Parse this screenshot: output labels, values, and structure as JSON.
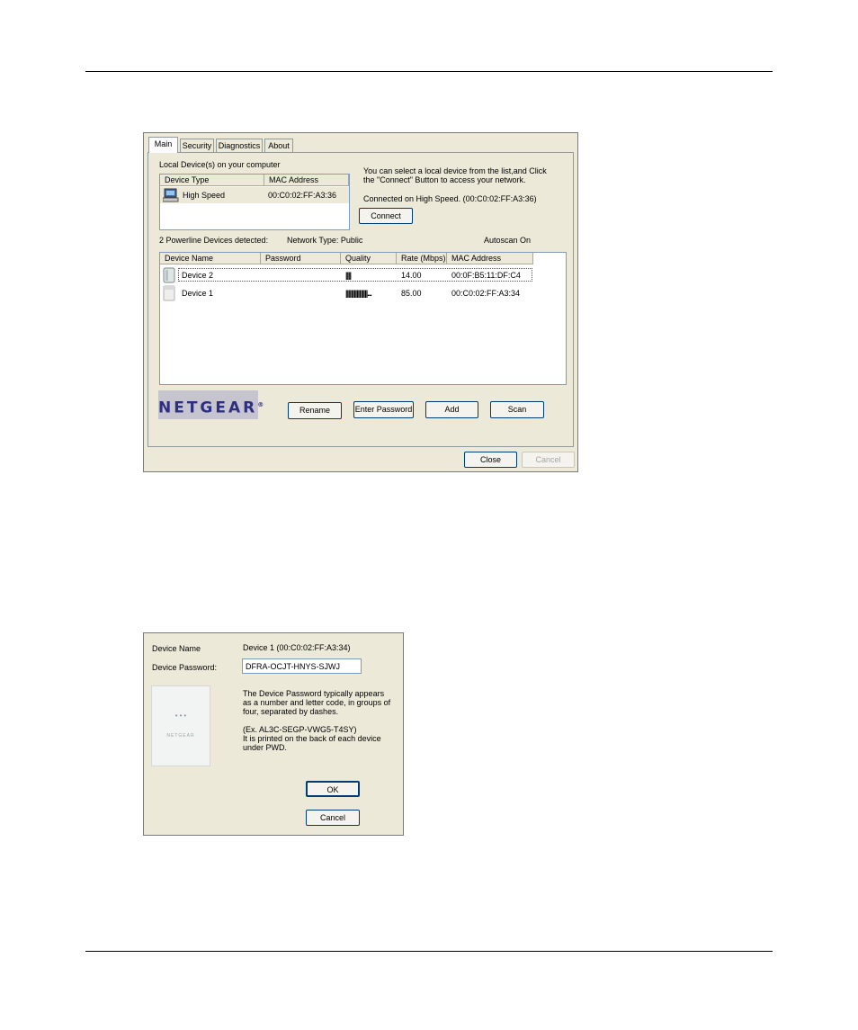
{
  "main_window": {
    "tabs": [
      "Main",
      "Security",
      "Diagnostics",
      "About"
    ],
    "local_devices_label": "Local Device(s) on your computer",
    "local_columns": [
      "Device Type",
      "MAC Address"
    ],
    "local_rows": [
      {
        "type": "High Speed",
        "mac": "00:C0:02:FF:A3:36"
      }
    ],
    "info_line1": "You can select a local device from the list,and Click",
    "info_line2": "the \"Connect\" Button to access your network.",
    "connected_on": "Connected on  High Speed. (00:C0:02:FF:A3:36)",
    "connect_button": "Connect",
    "detected": "2 Powerline Devices detected:",
    "network_type": "Network Type: Public",
    "autoscan": "Autoscan On",
    "device_columns": [
      "Device Name",
      "Password",
      "Quality",
      "Rate (Mbps)",
      "MAC Address"
    ],
    "devices": [
      {
        "name": "Device 2",
        "password": "",
        "quality": "||||",
        "rate": "14.00",
        "mac": "00:0F:B5:11:DF:C4"
      },
      {
        "name": "Device 1",
        "password": "",
        "quality": "||||||||||||||||...",
        "rate": "85.00",
        "mac": "00:C0:02:FF:A3:34"
      }
    ],
    "logo_text": "NETGEAR",
    "logo_mark": "®",
    "buttons": {
      "rename": "Rename",
      "enter_password": "Enter Password",
      "add": "Add",
      "scan": "Scan",
      "close": "Close",
      "cancel": "Cancel"
    }
  },
  "password_dialog": {
    "device_name_label": "Device Name",
    "device_name_value": "Device 1  (00:C0:02:FF:A3:34)",
    "device_password_label": "Device Password:",
    "device_password_value": "DFRA-OCJT-HNYS-SJWJ",
    "desc_line1": "The Device Password typically appears",
    "desc_line2": "as a number and letter code, in groups of",
    "desc_line3": "four, separated by dashes.",
    "example": "(Ex. AL3C-SEGP-VWG5-T4SY)",
    "printed_line1": "It is printed on the back of each device",
    "printed_line2": "under PWD.",
    "device_image_text": "NETGEAR",
    "ok_button": "OK",
    "cancel_button": "Cancel"
  }
}
